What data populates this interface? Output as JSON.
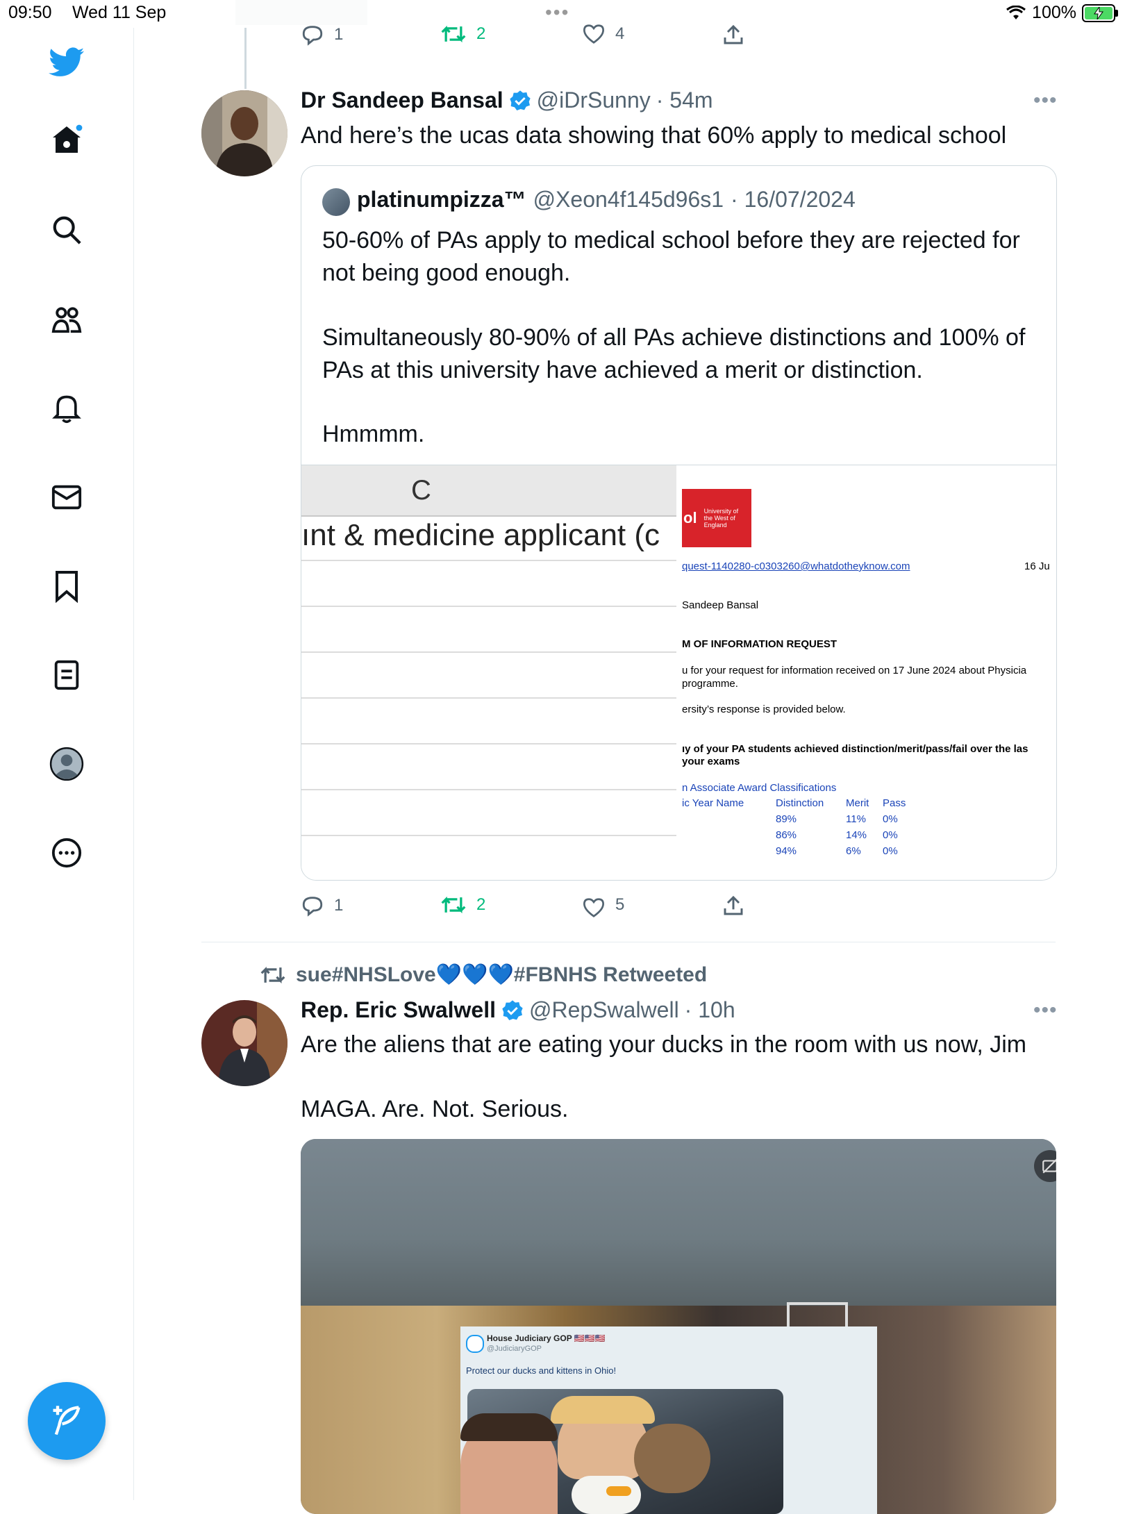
{
  "status_bar": {
    "time": "09:50",
    "date": "Wed 11 Sep",
    "battery": "100%"
  },
  "sidebar": {
    "items": [
      "twitter-logo",
      "home",
      "search",
      "communities",
      "notifications",
      "messages",
      "bookmarks",
      "lists",
      "profile",
      "more"
    ]
  },
  "top_actions": {
    "replies": "1",
    "retweets": "2",
    "likes": "4"
  },
  "tweet1": {
    "name": "Dr Sandeep Bansal",
    "handle": "@iDrSunny",
    "time": "· 54m",
    "text": "And here’s the ucas data showing that 60% apply to medical school",
    "quote": {
      "name": "platinumpizza™",
      "handle": "@Xeon4f145d96s1",
      "date": "· 16/07/2024",
      "para1": "50-60% of PAs apply to medical school before they are rejected for not being good enough.",
      "para2": "Simultaneously 80-90% of all PAs achieve distinctions and 100% of PAs at this university have achieved a merit or distinction.",
      "para3": "Hmmmm.",
      "sheet": {
        "column": "C",
        "header": "ınt & medicine applicant (c"
      },
      "doc": {
        "logo": "University of the West of England",
        "logo_prefix": "ol",
        "email": "quest-1140280-c0303260@whatdotheyknow.com",
        "date": "16 Ju",
        "recipient": "Sandeep Bansal",
        "heading": "M OF INFORMATION REQUEST",
        "line1": "u for your request for information received on 17 June 2024 about Physicia",
        "line2": "programme.",
        "line3": "ersity’s response is provided below.",
        "question1": "ıy of your PA students achieved distinction/merit/pass/fail over the las",
        "question2": "your exams",
        "table_title": "n Associate Award Classifications",
        "table_headers": [
          "ic Year Name",
          "Distinction",
          "Merit",
          "Pass"
        ],
        "rows": [
          [
            "89%",
            "11%",
            "0%"
          ],
          [
            "86%",
            "14%",
            "0%"
          ],
          [
            "94%",
            "6%",
            "0%"
          ]
        ]
      }
    },
    "actions": {
      "replies": "1",
      "retweets": "2",
      "likes": "5"
    }
  },
  "tweet2": {
    "retweeted_by": "sue#NHSLove💙💙💙#FBNHS Retweeted",
    "name": "Rep. Eric Swalwell",
    "handle": "@RepSwalwell",
    "time": "· 10h",
    "line1": "Are the aliens that are eating your ducks in the room with us now, Jim",
    "line2": "MAGA. Are. Not. Serious.",
    "embedded": {
      "account": "House Judiciary GOP 🇺🇸🇺🇸🇺🇸",
      "handle": "@JudiciaryGOP",
      "text": "Protect our ducks and kittens in Ohio!"
    }
  },
  "colors": {
    "accent": "#1d9bf0",
    "retweet_green": "#00ba7c",
    "text_secondary": "#536471"
  }
}
